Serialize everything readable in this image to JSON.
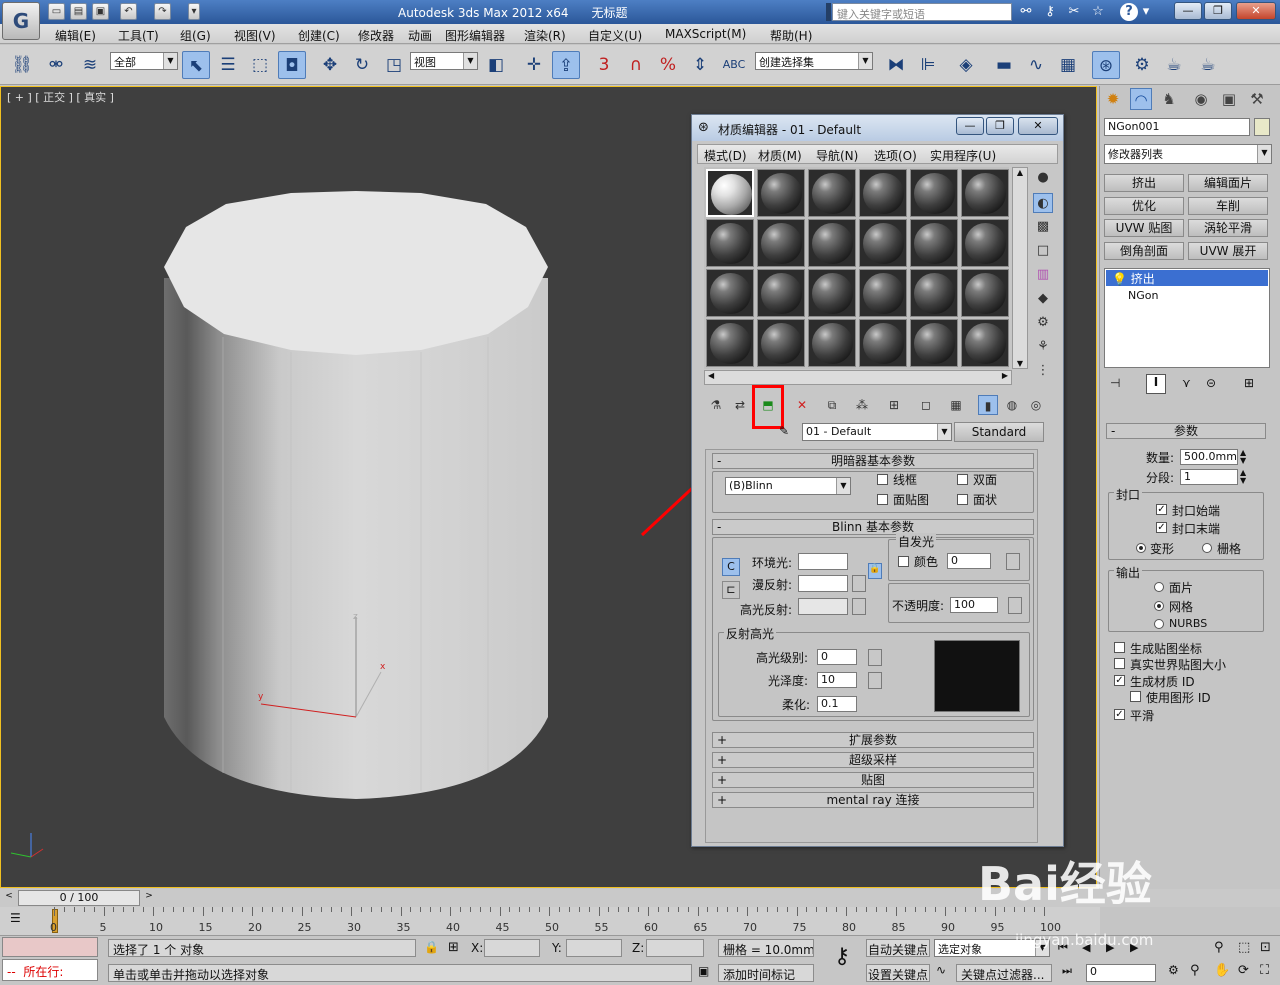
{
  "titlebar": {
    "title": "Autodesk 3ds Max  2012 x64",
    "doc": "无标题",
    "search_placeholder": "键入关键字或短语",
    "help_icon": "?"
  },
  "menubar": {
    "items": [
      "编辑(E)",
      "工具(T)",
      "组(G)",
      "视图(V)",
      "创建(C)",
      "修改器",
      "动画",
      "图形编辑器",
      "渲染(R)",
      "自定义(U)",
      "MAXScript(M)",
      "帮助(H)"
    ]
  },
  "toolbar": {
    "selection_filter": "全部",
    "ref_coord": "视图",
    "named_selection": "创建选择集",
    "snap_label": "3",
    "angle_label": "%"
  },
  "viewport": {
    "label": "[ + ] [ 正交 ] [ 真实 ]",
    "gizmo_x": "x",
    "gizmo_y": "y",
    "gizmo_z": "z"
  },
  "material_editor": {
    "title": "材质编辑器 - 01 - Default",
    "menus": [
      "模式(D)",
      "材质(M)",
      "导航(N)",
      "选项(O)",
      "实用程序(U)"
    ],
    "material_name": "01 - Default",
    "material_type": "Standard",
    "shader_rollout": "明暗器基本参数",
    "shader": "(B)Blinn",
    "wire": "线框",
    "two_sided": "双面",
    "face_map": "面贴图",
    "faceted": "面状",
    "blinn_rollout": "Blinn 基本参数",
    "self_illum": "自发光",
    "color_label": "颜色",
    "color_value": "0",
    "ambient": "环境光:",
    "diffuse": "漫反射:",
    "specular": "高光反射:",
    "opacity_label": "不透明度:",
    "opacity_value": "100",
    "spec_highlights": "反射高光",
    "spec_level": "高光级别:",
    "spec_level_value": "0",
    "glossiness": "光泽度:",
    "glossiness_value": "10",
    "soften": "柔化:",
    "soften_value": "0.1",
    "collapsed_rollouts": [
      "扩展参数",
      "超级采样",
      "贴图",
      "mental ray 连接"
    ],
    "lock_c": "C"
  },
  "command_panel": {
    "object_name": "NGon001",
    "modifier_list": "修改器列表",
    "buttons": [
      "挤出",
      "编辑面片",
      "优化",
      "车削",
      "UVW 贴图",
      "涡轮平滑",
      "倒角剖面",
      "UVW 展开"
    ],
    "stack": [
      "挤出",
      "NGon"
    ],
    "params_title": "参数",
    "amount_label": "数量:",
    "amount_value": "500.0mm",
    "segments_label": "分段:",
    "segments_value": "1",
    "capping": "封口",
    "cap_start": "封口始端",
    "cap_end": "封口末端",
    "morph": "变形",
    "grid": "栅格",
    "output": "输出",
    "patch": "面片",
    "mesh": "网格",
    "nurbs": "NURBS",
    "gen_map": "生成贴图坐标",
    "real_world": "真实世界贴图大小",
    "gen_mat_id": "生成材质 ID",
    "use_shape_id": "使用图形 ID",
    "smooth": "平滑"
  },
  "timeline": {
    "frame": "0 / 100",
    "ticks": [
      "0",
      "5",
      "10",
      "15",
      "20",
      "25",
      "30",
      "35",
      "40",
      "45",
      "50",
      "55",
      "60",
      "65",
      "70",
      "75",
      "80",
      "85",
      "90",
      "95",
      "100"
    ]
  },
  "statusbar": {
    "location": "所在行:",
    "selected": "选择了 1 个 对象",
    "prompt": "单击或单击并拖动以选择对象",
    "x_label": "X:",
    "y_label": "Y:",
    "z_label": "Z:",
    "grid": "栅格 = 10.0mm",
    "add_time_tag": "添加时间标记",
    "auto_key": "自动关键点",
    "selected_obj": "选定对象",
    "set_key": "设置关键点",
    "key_filters": "关键点过滤器...",
    "frame_value": "0"
  },
  "watermark": {
    "brand": "Bai经验",
    "url": "jingyan.baidu.com"
  },
  "colors": {
    "highlight": "#ff0000",
    "viewport_bg": "#3f3f3f",
    "active_border": "#f0c020"
  }
}
